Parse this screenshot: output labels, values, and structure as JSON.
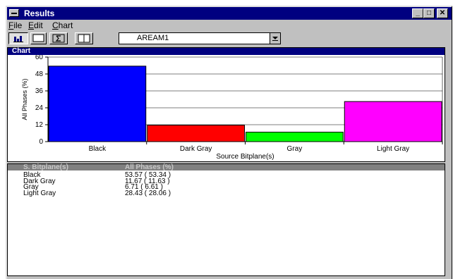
{
  "window": {
    "title": "Results"
  },
  "menu": {
    "file": "File",
    "edit": "Edit",
    "chart": "Chart"
  },
  "toolbar": {
    "selected": "AREAM1"
  },
  "chart_panel": {
    "title": "Chart"
  },
  "chart_data": {
    "type": "bar",
    "categories": [
      "Black",
      "Dark Gray",
      "Gray",
      "Light Gray"
    ],
    "values": [
      53.57,
      11.67,
      6.71,
      28.43
    ],
    "colors": [
      "#0000ff",
      "#ff0000",
      "#00ff00",
      "#ff00ff"
    ],
    "ylabel": "All Phases (%)",
    "xlabel": "Source Bitplane(s)",
    "ylim": [
      0,
      60
    ],
    "yticks": [
      "0",
      "12",
      "24",
      "36",
      "48",
      "60"
    ],
    "grid": true
  },
  "table": {
    "headers": [
      "S. Bitplane(s)",
      "All Phases (%)"
    ],
    "rows": [
      {
        "name": "Black",
        "value": "53.57 ( 53.34 )"
      },
      {
        "name": "Dark Gray",
        "value": "11.67 ( 11.63 )"
      },
      {
        "name": "Gray",
        "value": "6.71 ( 6.61 )"
      },
      {
        "name": "Light Gray",
        "value": "28.43 ( 28.06 )"
      }
    ]
  }
}
